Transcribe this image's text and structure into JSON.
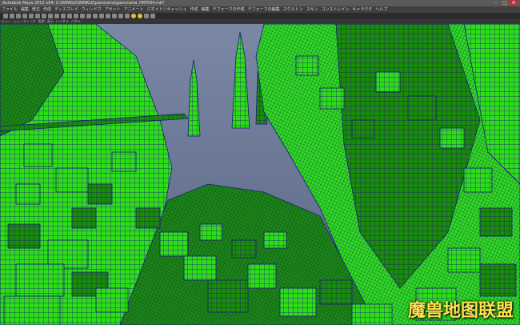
{
  "window": {
    "title": "Autodesk Maya 2012 x64: Z:\\WINKLE\\WINKLE\\panorama\\panorama_HRT004.mb*",
    "controls": [
      "–",
      "□",
      "✕"
    ]
  },
  "menubar": {
    "items": [
      "ファイル",
      "編集",
      "修正",
      "作成",
      "ディスプレイ",
      "ウィンドウ",
      "アセット",
      "アニメート",
      "ジオメトリキャッシュ",
      "作成",
      "編集",
      "デフォーマの作成",
      "デフォーマの編集",
      "スケルトン",
      "スキン",
      "コンストレイン",
      "キャラクタ",
      "ヘルプ"
    ]
  },
  "panel_menu": {
    "items": [
      "ビュー",
      "シェーディング",
      "照明",
      "表示",
      "レンダラ",
      "パネル"
    ]
  },
  "viewport": {
    "render_mode": "wireframe-on-shaded",
    "colors": {
      "sky": "#6a7894",
      "geometry": "#2edc1a",
      "geometry_dark": "#1a8a0a",
      "wireframe": "#1a1a7a"
    }
  },
  "watermark": {
    "text": "魔兽地图联盟"
  }
}
